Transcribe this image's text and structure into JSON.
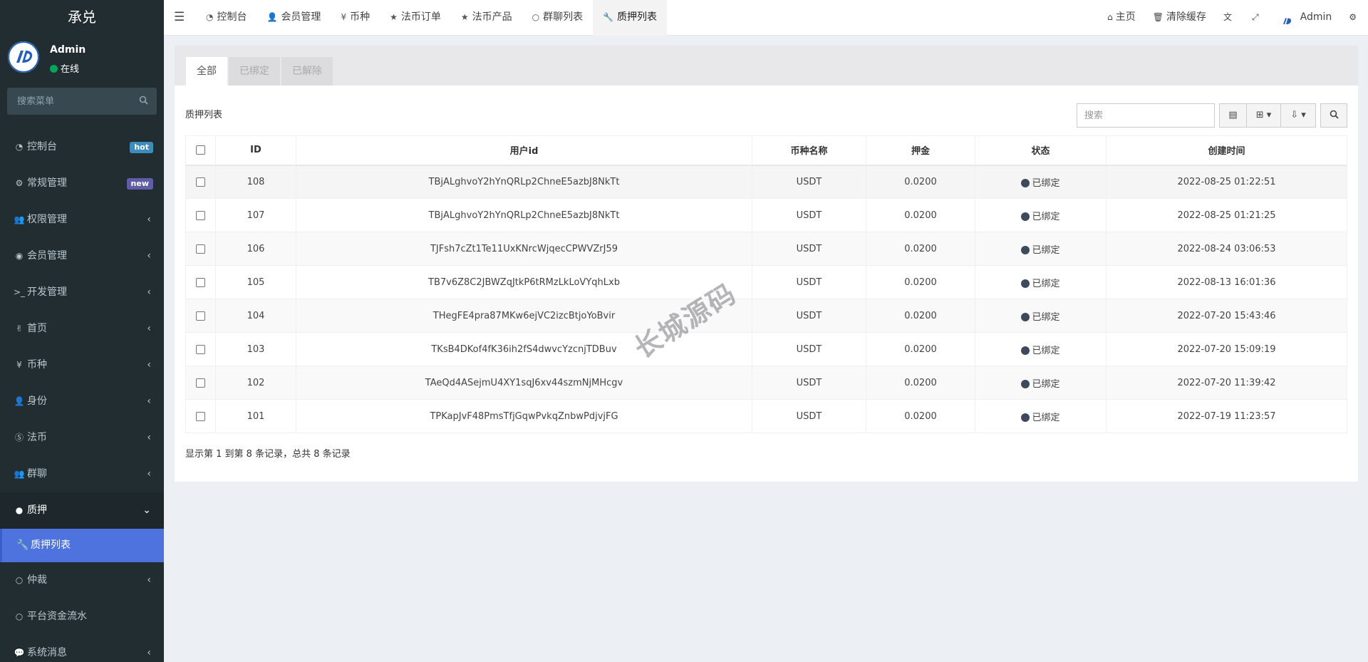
{
  "sidebar": {
    "brand": "承兑",
    "user": {
      "name": "Admin",
      "status": "在线"
    },
    "search_placeholder": "搜索菜单",
    "items": [
      {
        "label": "控制台",
        "icon": "dashboard-icon",
        "badge": "hot"
      },
      {
        "label": "常规管理",
        "icon": "cogs-icon",
        "badge": "new"
      },
      {
        "label": "权限管理",
        "icon": "group-icon"
      },
      {
        "label": "会员管理",
        "icon": "user-circle-icon"
      },
      {
        "label": "开发管理",
        "icon": "terminal-icon"
      },
      {
        "label": "首页",
        "icon": "hand-icon"
      },
      {
        "label": "币种",
        "icon": "yen-icon"
      },
      {
        "label": "身份",
        "icon": "user-icon"
      },
      {
        "label": "法币",
        "icon": "skype-icon"
      },
      {
        "label": "群聊",
        "icon": "users-icon"
      },
      {
        "label": "质押",
        "icon": "circle-icon"
      },
      {
        "label": "仲裁",
        "icon": "circle-o-icon"
      },
      {
        "label": "平台资金流水",
        "icon": "circle-o-icon"
      },
      {
        "label": "系统消息",
        "icon": "comment-icon"
      }
    ],
    "active_sub": "质押列表"
  },
  "navbar": {
    "tabs": [
      {
        "label": "控制台",
        "icon": "dashboard-icon"
      },
      {
        "label": "会员管理",
        "icon": "user-icon"
      },
      {
        "label": "币种",
        "icon": "yen-icon"
      },
      {
        "label": "法币订单",
        "icon": "star-icon"
      },
      {
        "label": "法币产品",
        "icon": "star-icon"
      },
      {
        "label": "群聊列表",
        "icon": "circle-o-icon"
      },
      {
        "label": "质押列表",
        "icon": "wrench-icon"
      }
    ],
    "right": {
      "home": "主页",
      "clear_cache": "清除缓存",
      "admin": "Admin"
    }
  },
  "content": {
    "tabs": [
      "全部",
      "已绑定",
      "已解除"
    ],
    "title": "质押列表",
    "search_placeholder": "搜索",
    "columns": [
      "ID",
      "用户id",
      "币种名称",
      "押金",
      "状态",
      "创建时间"
    ],
    "rows": [
      {
        "id": "108",
        "uid": "TBjALghvoY2hYnQRLp2ChneE5azbJ8NkTt",
        "coin": "USDT",
        "deposit": "0.0200",
        "status": "已绑定",
        "time": "2022-08-25 01:22:51"
      },
      {
        "id": "107",
        "uid": "TBjALghvoY2hYnQRLp2ChneE5azbJ8NkTt",
        "coin": "USDT",
        "deposit": "0.0200",
        "status": "已绑定",
        "time": "2022-08-25 01:21:25"
      },
      {
        "id": "106",
        "uid": "TJFsh7cZt1Te11UxKNrcWjqecCPWVZrJ59",
        "coin": "USDT",
        "deposit": "0.0200",
        "status": "已绑定",
        "time": "2022-08-24 03:06:53"
      },
      {
        "id": "105",
        "uid": "TB7v6Z8C2JBWZqJtkP6tRMzLkLoVYqhLxb",
        "coin": "USDT",
        "deposit": "0.0200",
        "status": "已绑定",
        "time": "2022-08-13 16:01:36"
      },
      {
        "id": "104",
        "uid": "THegFE4pra87MKw6ejVC2izcBtjoYoBvir",
        "coin": "USDT",
        "deposit": "0.0200",
        "status": "已绑定",
        "time": "2022-07-20 15:43:46"
      },
      {
        "id": "103",
        "uid": "TKsB4DKof4fK36ih2fS4dwvcYzcnjTDBuv",
        "coin": "USDT",
        "deposit": "0.0200",
        "status": "已绑定",
        "time": "2022-07-20 15:09:19"
      },
      {
        "id": "102",
        "uid": "TAeQd4ASejmU4XY1sqJ6xv44szmNjMHcgv",
        "coin": "USDT",
        "deposit": "0.0200",
        "status": "已绑定",
        "time": "2022-07-20 11:39:42"
      },
      {
        "id": "101",
        "uid": "TPKapJvF48PmsTfjGqwPvkqZnbwPdjvjFG",
        "coin": "USDT",
        "deposit": "0.0200",
        "status": "已绑定",
        "time": "2022-07-19 11:23:57"
      }
    ],
    "pager": "显示第 1 到第 8 条记录，总共 8 条记录"
  },
  "watermark": "长城源码",
  "colors": {
    "sidebar_bg": "#222d32",
    "active_menu": "#4e73df",
    "status_dot": "#3c4a5c",
    "online": "#00a65a"
  }
}
